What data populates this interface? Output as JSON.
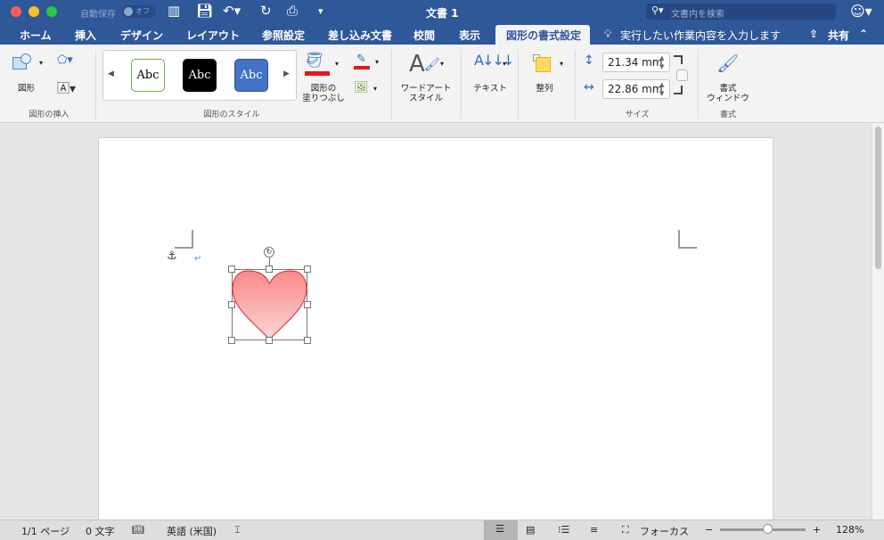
{
  "titlebar": {
    "autosave_label": "自動保存",
    "autosave_state": "オフ",
    "doc_title": "文書 1",
    "search_placeholder": "文書内を検索"
  },
  "tabs": [
    {
      "label": "ホーム"
    },
    {
      "label": "挿入"
    },
    {
      "label": "デザイン"
    },
    {
      "label": "レイアウト"
    },
    {
      "label": "参照設定"
    },
    {
      "label": "差し込み文書"
    },
    {
      "label": "校閲"
    },
    {
      "label": "表示"
    },
    {
      "label": "図形の書式設定",
      "active": true
    }
  ],
  "tell_me": "実行したい作業内容を入力します",
  "share": "共有",
  "ribbon": {
    "insert_shapes": {
      "shapes_label": "図形",
      "group_label": "図形の挿入"
    },
    "shape_styles": {
      "samples": [
        "Abc",
        "Abc",
        "Abc"
      ],
      "fill_label_1": "図形の",
      "fill_label_2": "塗りつぶし",
      "group_label": "図形のスタイル"
    },
    "wordart": {
      "label_1": "ワードアート",
      "label_2": "スタイル"
    },
    "text": {
      "label": "テキスト"
    },
    "arrange": {
      "label": "整列"
    },
    "size": {
      "height": "21.34 mm",
      "width": "22.86 mm",
      "group_label": "サイズ"
    },
    "format": {
      "label_1": "書式",
      "label_2": "ウィンドウ",
      "group_label": "書式"
    }
  },
  "status": {
    "page": "1/1 ページ",
    "words": "0 文字",
    "language": "英語 (米国)",
    "focus": "フォーカス",
    "zoom": "128%",
    "zoom_fraction": 0.55
  },
  "colors": {
    "title_blue": "#2f5899",
    "heart_fill_top": "#f88a8a",
    "heart_fill_bottom": "#fcd0d0",
    "heart_stroke": "#e8202a",
    "fill_red": "#e8141e"
  }
}
